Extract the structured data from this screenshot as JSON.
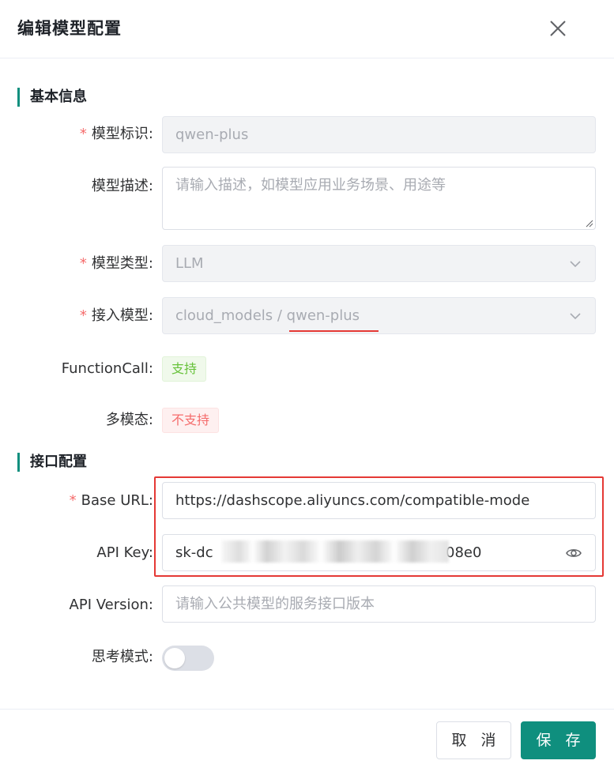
{
  "dialog": {
    "title": "编辑模型配置"
  },
  "sections": {
    "basic": "基本信息",
    "api": "接口配置"
  },
  "fields": {
    "model_id": {
      "label": "模型标识:",
      "required": "*",
      "value": "qwen-plus"
    },
    "description": {
      "label": "模型描述:",
      "placeholder": "请输入描述，如模型应用业务场景、用途等"
    },
    "model_type": {
      "label": "模型类型:",
      "required": "*",
      "value": "LLM"
    },
    "access_model": {
      "label": "接入模型:",
      "required": "*",
      "value": "cloud_models / qwen-plus"
    },
    "function_call": {
      "label": "FunctionCall:",
      "tag": "支持"
    },
    "multimodal": {
      "label": "多模态:",
      "tag": "不支持"
    },
    "base_url": {
      "label": "Base URL:",
      "required": "*",
      "value": "https://dashscope.aliyuncs.com/compatible-mode"
    },
    "api_key": {
      "label": "API Key:",
      "value_prefix": "sk-dc",
      "value_suffix": "08e0"
    },
    "api_version": {
      "label": "API Version:",
      "placeholder": "请输入公共模型的服务接口版本"
    },
    "thinking_mode": {
      "label": "思考模式:",
      "enabled": false
    }
  },
  "footer": {
    "cancel": "取 消",
    "save": "保 存"
  },
  "colors": {
    "primary": "#0f8f7e",
    "required": "#f56c6c",
    "success_tag": "#67c23a",
    "danger_tag": "#f56c6c",
    "annotation": "#e53935"
  },
  "icons": {
    "close": "close-icon",
    "select_arrow": "chevron-down-icon",
    "password_toggle": "eye-icon"
  }
}
